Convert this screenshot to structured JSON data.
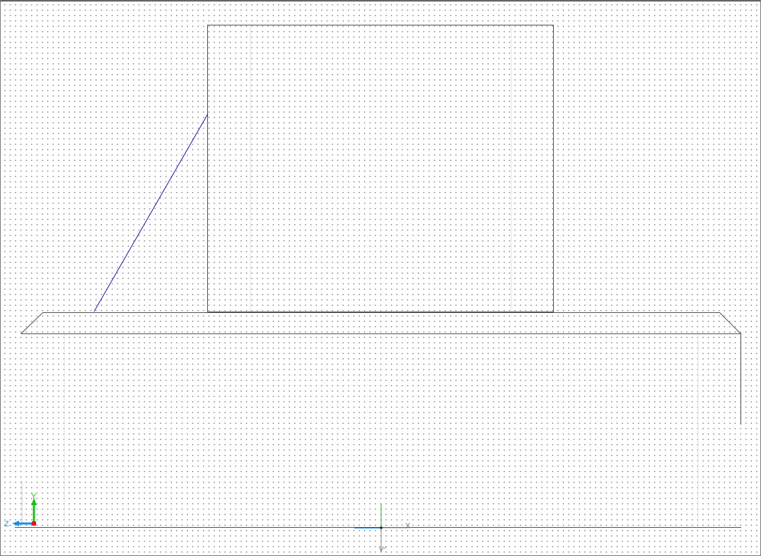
{
  "viewport": {
    "name": "drawing-viewport",
    "colors": {
      "background": "#ffffff",
      "grid_dots": "#6e6e6e",
      "geometry": "#505050",
      "selected_line": "#1a1aa8",
      "axis_x": "#ff2020",
      "axis_y": "#18c018",
      "axis_z": "#1890e0"
    }
  },
  "corner_gizmo": {
    "x_label": "",
    "y_label": "Y",
    "z_label": "Z"
  },
  "origin_gizmo": {
    "x_label": "X",
    "y_label": "",
    "z_label": ""
  },
  "icons": {
    "corner_axis": "axis-triad-icon",
    "origin_marker": "ucs-origin-icon"
  }
}
